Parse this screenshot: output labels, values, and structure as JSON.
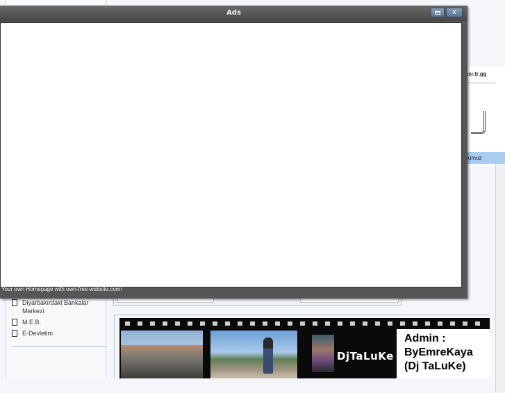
{
  "ads_window": {
    "title": "Ads",
    "minimize_glyph": "",
    "close_glyph": "x",
    "footer_text": "Your own Homepage with own-free-website.com!"
  },
  "right_panel": {
    "title": "nası.tr.gg",
    "active_item": "ubumuz"
  },
  "sidebar": {
    "items": [
      {
        "label": "Diyarbakırdaki Bankalar Merkezi",
        "icon": "document-icon"
      },
      {
        "label": "M.E.B.",
        "icon": "document-icon"
      },
      {
        "label": "E-Devletim",
        "icon": "document-icon"
      }
    ]
  },
  "banner": {
    "logo_text": "DjTaLuKe",
    "admin_lines": [
      "Admin :",
      "ByEmreKaya",
      "(Dj TaLuKe)"
    ]
  },
  "colors": {
    "titlebar": "#565656",
    "active_item": "#a9cdf0",
    "film_strip": "#0a0a0a"
  }
}
